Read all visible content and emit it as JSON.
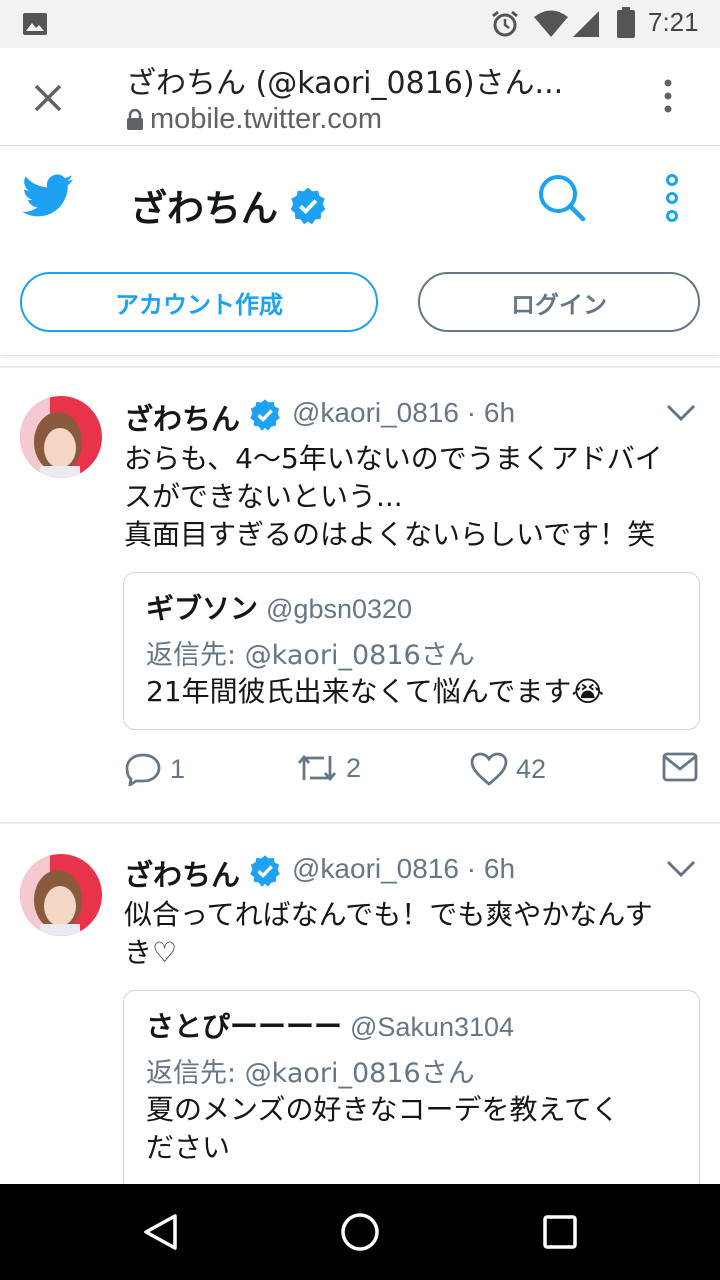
{
  "status_bar": {
    "time": "7:21"
  },
  "browser": {
    "page_title": "ざわちん (@kaori_0816)さん...",
    "url": "mobile.twitter.com"
  },
  "header": {
    "profile_name": "ざわちん",
    "signup_label": "アカウント作成",
    "login_label": "ログイン"
  },
  "colors": {
    "twitter_blue": "#1da1f2",
    "secondary_gray": "#657786"
  },
  "tweets": [
    {
      "name": "ざわちん",
      "handle": "@kaori_0816",
      "time": "6h",
      "text_lines": [
        "おらも、4〜5年いないのでうまくアドバイ",
        "スができないという...",
        "真面目すぎるのはよくないらしいです！笑"
      ],
      "quote": {
        "name": "ギブソン",
        "handle": "@gbsn0320",
        "reply_to": "返信先: @kaori_0816さん",
        "text": "21年間彼氏出来なくて悩んでます😭"
      },
      "replies": "1",
      "retweets": "2",
      "likes": "42"
    },
    {
      "name": "ざわちん",
      "handle": "@kaori_0816",
      "time": "6h",
      "text_lines": [
        "似合ってればなんでも！でも爽やかなんす",
        "き♡"
      ],
      "quote": {
        "name": "さとぴーーーー",
        "handle": "@Sakun3104",
        "reply_to": "返信先: @kaori_0816さん",
        "text_lines": [
          "夏のメンズの好きなコーデを教えてく",
          "ださい"
        ]
      }
    }
  ]
}
